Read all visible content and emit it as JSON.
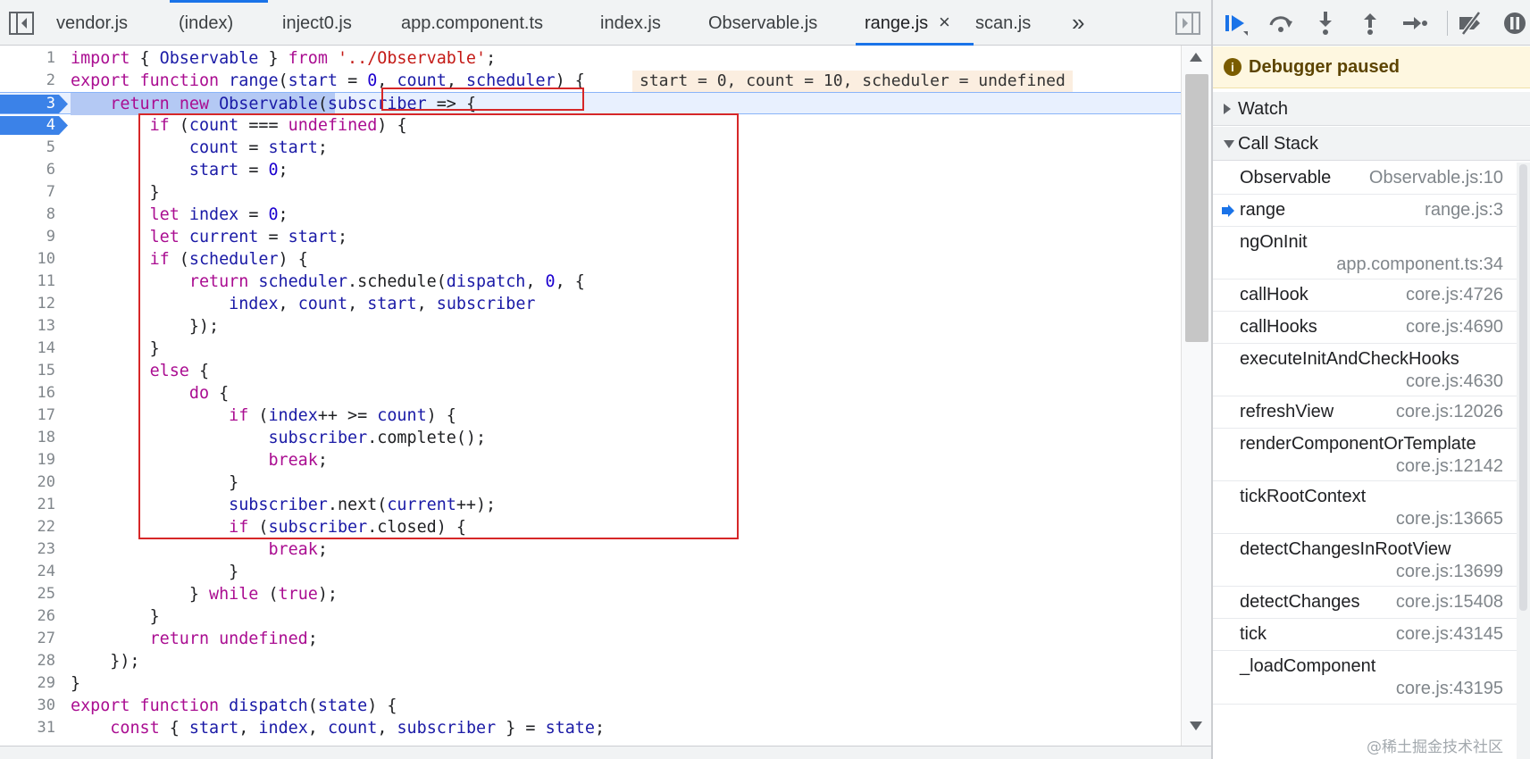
{
  "tabs": [
    {
      "label": "vendor.js"
    },
    {
      "label": "(index)"
    },
    {
      "label": "inject0.js"
    },
    {
      "label": "app.component.ts"
    },
    {
      "label": "index.js"
    },
    {
      "label": "Observable.js"
    },
    {
      "label": "range.js",
      "active": true
    },
    {
      "label": "scan.js"
    }
  ],
  "tab_close": "×",
  "tab_overflow": "»",
  "inline_values": "start = 0, count = 10, scheduler = undefined",
  "code_lines": [
    {
      "n": "1"
    },
    {
      "n": "2"
    },
    {
      "n": "3"
    },
    {
      "n": "4"
    },
    {
      "n": "5"
    },
    {
      "n": "6"
    },
    {
      "n": "7"
    },
    {
      "n": "8"
    },
    {
      "n": "9"
    },
    {
      "n": "10"
    },
    {
      "n": "11"
    },
    {
      "n": "12"
    },
    {
      "n": "13"
    },
    {
      "n": "14"
    },
    {
      "n": "15"
    },
    {
      "n": "16"
    },
    {
      "n": "17"
    },
    {
      "n": "18"
    },
    {
      "n": "19"
    },
    {
      "n": "20"
    },
    {
      "n": "21"
    },
    {
      "n": "22"
    },
    {
      "n": "23"
    },
    {
      "n": "24"
    },
    {
      "n": "25"
    },
    {
      "n": "26"
    },
    {
      "n": "27"
    },
    {
      "n": "28"
    },
    {
      "n": "29"
    },
    {
      "n": "30"
    },
    {
      "n": "31"
    }
  ],
  "code_text": [
    "import { Observable } from '../Observable';",
    "export function range(start = 0, count, scheduler) {",
    "    return new Observable(subscriber => {",
    "        if (count === undefined) {",
    "            count = start;",
    "            start = 0;",
    "        }",
    "        let index = 0;",
    "        let current = start;",
    "        if (scheduler) {",
    "            return scheduler.schedule(dispatch, 0, {",
    "                index, count, start, subscriber",
    "            });",
    "        }",
    "        else {",
    "            do {",
    "                if (index++ >= count) {",
    "                    subscriber.complete();",
    "                    break;",
    "                }",
    "                subscriber.next(current++);",
    "                if (subscriber.closed) {",
    "                    break;",
    "                }",
    "            } while (true);",
    "        }",
    "        return undefined;",
    "    });",
    "}",
    "export function dispatch(state) {",
    "    const { start, index, count, subscriber } = state;"
  ],
  "debugger": {
    "paused_icon": "i",
    "paused_text": "Debugger paused",
    "watch_label": "Watch",
    "callstack_label": "Call Stack",
    "frames": [
      {
        "name": "Observable",
        "loc": "Observable.js:10"
      },
      {
        "name": "range",
        "loc": "range.js:3",
        "current": true
      },
      {
        "name": "ngOnInit",
        "loc": "app.component.ts:34",
        "wrap": true
      },
      {
        "name": "callHook",
        "loc": "core.js:4726"
      },
      {
        "name": "callHooks",
        "loc": "core.js:4690"
      },
      {
        "name": "executeInitAndCheckHooks",
        "loc": "core.js:4630",
        "wrap": true
      },
      {
        "name": "refreshView",
        "loc": "core.js:12026"
      },
      {
        "name": "renderComponentOrTemplate",
        "loc": "core.js:12142",
        "wrap": true
      },
      {
        "name": "tickRootContext",
        "loc": "core.js:13665",
        "wrap": true
      },
      {
        "name": "detectChangesInRootView",
        "loc": "core.js:13699",
        "wrap": true
      },
      {
        "name": "detectChanges",
        "loc": "core.js:15408"
      },
      {
        "name": "tick",
        "loc": "core.js:43145"
      },
      {
        "name": "_loadComponent",
        "loc": "core.js:43195",
        "wrap": true
      }
    ]
  },
  "watermark": "@稀土掘金技术社区",
  "colors": {
    "accent": "#1a73e8",
    "breakpoint": "#3b82e8",
    "annotation": "#d62728",
    "paused_banner": "#fef7e0"
  }
}
